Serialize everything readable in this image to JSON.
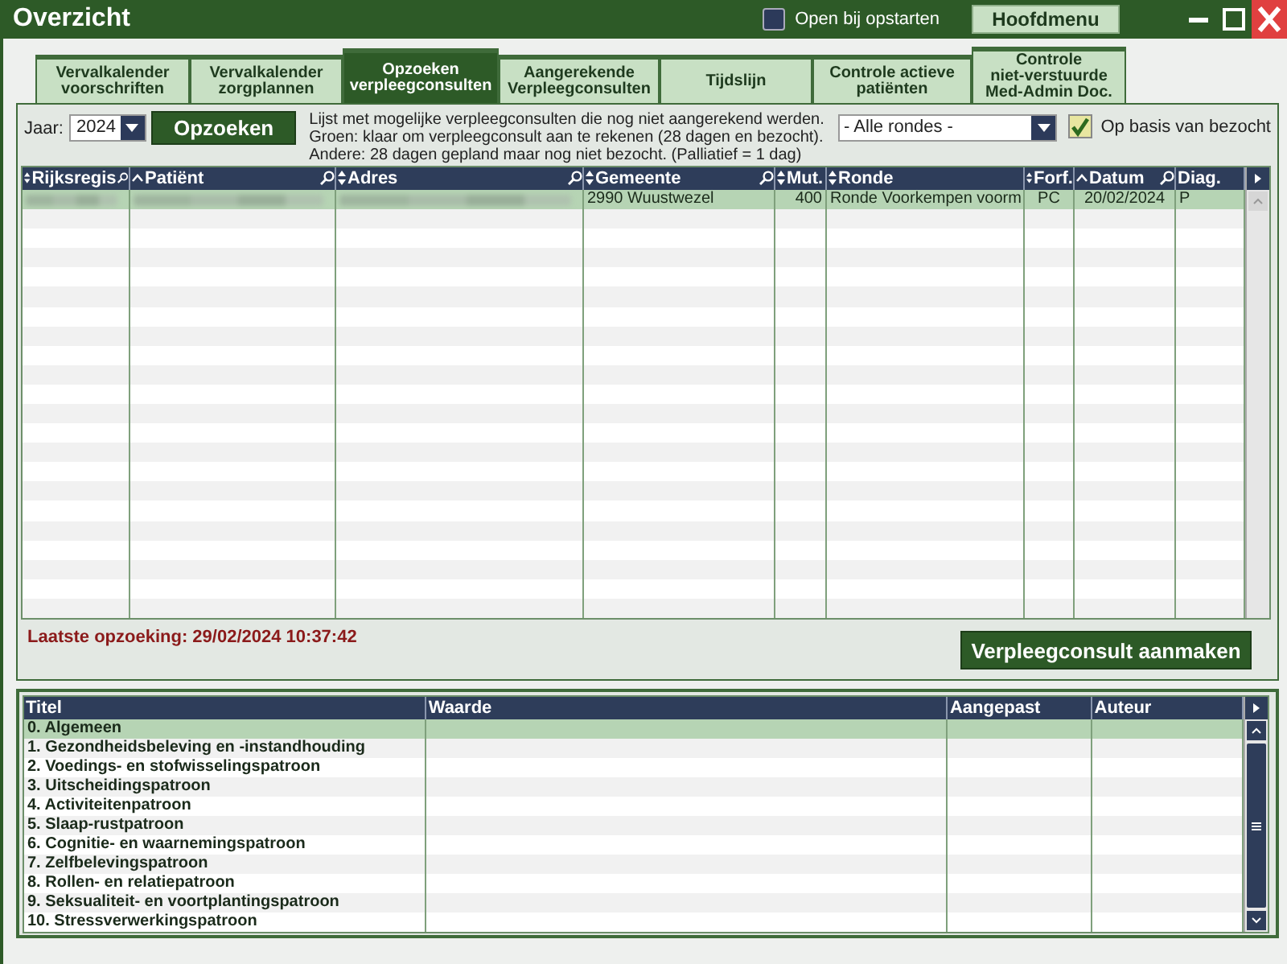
{
  "window": {
    "title": "Overzicht",
    "open_on_startup": {
      "label": "Open bij opstarten",
      "checked": false
    },
    "main_menu_button": "Hoofdmenu"
  },
  "tabs": [
    {
      "label": "Vervalkalender\nvoorschriften",
      "selected": false
    },
    {
      "label": "Vervalkalender\nzorgplannen",
      "selected": false
    },
    {
      "label": "Opzoeken\nverpleegconsulten",
      "selected": true
    },
    {
      "label": "Aangerekende\nVerpleegconsulten",
      "selected": false
    },
    {
      "label": "Tijdslijn",
      "selected": false
    },
    {
      "label": "Controle actieve\npatiënten",
      "selected": false
    },
    {
      "label": "Controle\nniet-verstuurde\nMed-Admin Doc.",
      "selected": false
    }
  ],
  "filters": {
    "year_label": "Jaar:",
    "year": "2024",
    "search_button": "Opzoeken",
    "info": [
      "Lijst met mogelijke verpleegconsulten die nog niet aangerekend werden.",
      "Groen: klaar om verpleegconsult aan te rekenen (28 dagen en bezocht).",
      "Andere: 28 dagen gepland maar nog niet bezocht. (Palliatief = 1 dag)"
    ],
    "round_select": "- Alle rondes -",
    "visited_checkbox": {
      "label": "Op basis van bezocht",
      "checked": true
    }
  },
  "consults_table": {
    "columns": [
      {
        "label": "Rijksregis",
        "sortable": true,
        "sorted": false,
        "filter": true
      },
      {
        "label": "Patiënt",
        "sortable": true,
        "sorted": true,
        "filter": true
      },
      {
        "label": "Adres",
        "sortable": true,
        "sorted": false,
        "filter": true
      },
      {
        "label": "Gemeente",
        "sortable": true,
        "sorted": false,
        "filter": true
      },
      {
        "label": "Mut.",
        "sortable": true,
        "sorted": false,
        "filter": false
      },
      {
        "label": "Ronde",
        "sortable": true,
        "sorted": false,
        "filter": false
      },
      {
        "label": "Forf.",
        "sortable": true,
        "sorted": false,
        "filter": false
      },
      {
        "label": "Datum",
        "sortable": true,
        "sorted": true,
        "filter": true
      },
      {
        "label": "Diag.",
        "sortable": false,
        "sorted": false,
        "filter": false
      }
    ],
    "rows": [
      {
        "selected": true,
        "cells": [
          {
            "kind": "blurred"
          },
          {
            "kind": "blurred"
          },
          {
            "kind": "blurred"
          },
          {
            "kind": "text",
            "text": "2990 Wuustwezel"
          },
          {
            "kind": "text",
            "text": "400"
          },
          {
            "kind": "text",
            "text": "Ronde Voorkempen voorm"
          },
          {
            "kind": "text",
            "text": "PC"
          },
          {
            "kind": "text",
            "text": "20/02/2024"
          },
          {
            "kind": "text",
            "text": "P"
          }
        ]
      }
    ]
  },
  "last_search": "Laatste opzoeking: 29/02/2024 10:37:42",
  "create_button": "Verpleegconsult aanmaken",
  "patterns_table": {
    "columns": [
      "Titel",
      "Waarde",
      "Aangepast",
      "Auteur"
    ],
    "rows": [
      {
        "title": "0. Algemeen",
        "selected": true
      },
      {
        "title": "1. Gezondheidsbeleving en -instandhouding",
        "selected": false
      },
      {
        "title": "2. Voedings- en stofwisselingspatroon",
        "selected": false
      },
      {
        "title": "3. Uitscheidingspatroon",
        "selected": false
      },
      {
        "title": "4. Activiteitenpatroon",
        "selected": false
      },
      {
        "title": "5. Slaap-rustpatroon",
        "selected": false
      },
      {
        "title": "6. Cognitie- en waarnemingspatroon",
        "selected": false
      },
      {
        "title": "7. Zelfbelevingspatroon",
        "selected": false
      },
      {
        "title": "8. Rollen- en relatiepatroon",
        "selected": false
      },
      {
        "title": "9. Seksualiteit- en voortplantingspatroon",
        "selected": false
      },
      {
        "title": "10. Stressverwerkingspatroon",
        "selected": false
      }
    ]
  }
}
